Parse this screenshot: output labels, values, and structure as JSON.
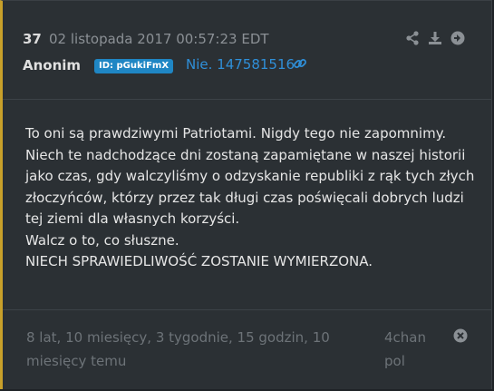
{
  "post": {
    "number": "37",
    "date": "02 listopada 2017 00:57:23 EDT",
    "author": "Anonim",
    "id_badge": "ID: pGukiFmX",
    "link_text": "Nie. 147581516",
    "body": [
      "To oni są prawdziwymi Patriotami. Nigdy tego nie zapomnimy.",
      "Niech te nadchodzące dni zostaną zapamiętane w naszej historii",
      "jako czas, gdy walczyliśmy o odzyskanie republiki z rąk tych złych",
      "złoczyńców, którzy przez tak długi czas poświęcali dobrych ludzi",
      "tej ziemi dla własnych korzyści.",
      "Walcz o to, co słuszne.",
      "NIECH SPRAWIEDLIWOŚĆ ZOSTANIE WYMIERZONA."
    ],
    "age": "8 lat, 10 miesięcy, 3 tygodnie, 15 godzin, 10 miesięcy temu",
    "source": "4chan pol"
  },
  "icons": {
    "share": "share-icon",
    "download": "download-icon",
    "open": "arrow-right-circle-icon",
    "link": "link-icon",
    "close": "close-circle-icon"
  },
  "colors": {
    "accent_border": "#c8a02a",
    "badge": "#1f86c4",
    "link": "#2f8fd8"
  }
}
